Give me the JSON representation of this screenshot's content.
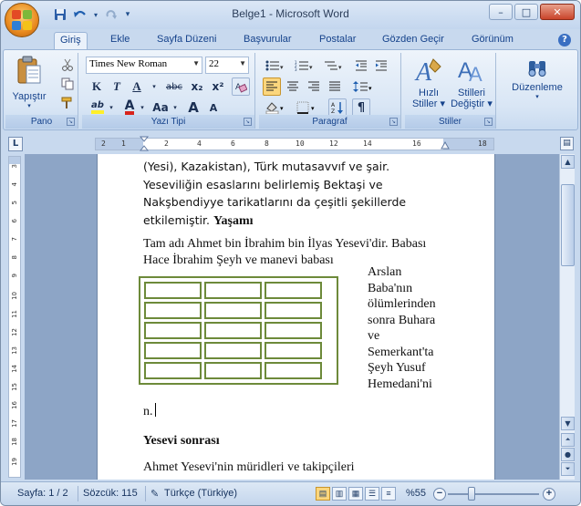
{
  "window": {
    "title": "Belge1 - Microsoft Word",
    "controls": {
      "minimize": "–",
      "maximize": "□",
      "close": "✕"
    }
  },
  "qat": {
    "save_icon": "save-icon",
    "undo_icon": "undo-icon",
    "redo_icon": "redo-icon",
    "customize": "▾"
  },
  "tabs": [
    {
      "label": "Giriş",
      "active": true
    },
    {
      "label": "Ekle"
    },
    {
      "label": "Sayfa Düzeni"
    },
    {
      "label": "Başvurular"
    },
    {
      "label": "Postalar"
    },
    {
      "label": "Gözden Geçir"
    },
    {
      "label": "Görünüm"
    }
  ],
  "ribbon": {
    "groups": {
      "pano": "Pano",
      "yazi_tipi": "Yazı Tipi",
      "paragraf": "Paragraf",
      "stiller": "Stiller"
    },
    "paste_label": "Yapıştır",
    "font_name": "Times New Roman",
    "font_size": "22",
    "bold": "K",
    "italic": "T",
    "underline": "A",
    "strike": "abc",
    "subscript": "x₂",
    "superscript": "x²",
    "grow_font": "A",
    "shrink_font": "A",
    "change_case": "Aa",
    "highlight": "ab",
    "font_color": "A",
    "quick_styles_line1": "Hızlı",
    "quick_styles_line2": "Stiller",
    "change_styles_line1": "Stilleri",
    "change_styles_line2": "Değiştir",
    "editing_label": "Düzenleme"
  },
  "ruler": {
    "marks": [
      "2",
      "1",
      "2",
      "4",
      "6",
      "8",
      "10",
      "12",
      "14",
      "16",
      "18"
    ],
    "vmarks": [
      "3",
      "4",
      "5",
      "6",
      "7",
      "8",
      "9",
      "10",
      "11",
      "12",
      "13",
      "14",
      "15",
      "16",
      "17",
      "18",
      "19"
    ]
  },
  "document": {
    "para1": "(Yesi), Kazakistan), Türk mutasavvıf ve şair. Yeseviliğin esaslarını belirlemiş Bektaşi ve Nakşbendiyye tarikatlarını da çeşitli şekillerde etkilemiştir.",
    "para1_bold": "Yaşamı",
    "para2": "Tam adı Ahmet bin İbrahim bin İlyas Yesevi'dir. Babası Hace İbrahim Şeyh ve manevi babası",
    "wrap_lines": [
      "Arslan",
      "Baba'nın",
      "ölümlerinden",
      "sonra Buhara",
      "ve",
      "Semerkant'ta",
      "Şeyh Yusuf",
      "Hemedani'ni"
    ],
    "wrap_end": "n.",
    "heading": "Yesevi sonrası",
    "para3": "Ahmet Yesevi'nin müridleri ve takipçileri",
    "table": {
      "rows": 5,
      "cols": 3
    }
  },
  "statusbar": {
    "page": "Sayfa: 1 / 2",
    "words": "Sözcük: 115",
    "language": "Türkçe (Türkiye)",
    "zoom": "%55",
    "zoom_percent": 55
  },
  "colors": {
    "table_border": "#6d8a3a",
    "ribbon_text": "#15428b"
  }
}
